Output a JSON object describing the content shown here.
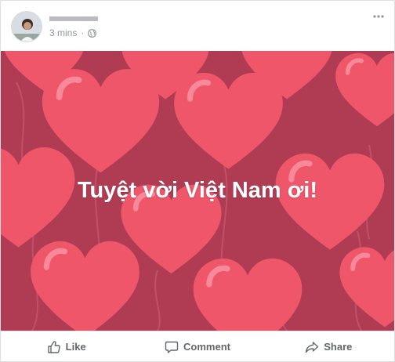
{
  "post": {
    "author_name": "",
    "timestamp": "3 mins",
    "privacy_icon": "globe-icon",
    "more_icon": "more-options-icon",
    "background_color": "#b03c54",
    "heart_color": "#f0566a",
    "text": "Tuyệt vời Việt Nam ơi!"
  },
  "actions": {
    "like": {
      "label": "Like",
      "icon": "thumbs-up-icon"
    },
    "comment": {
      "label": "Comment",
      "icon": "comment-icon"
    },
    "share": {
      "label": "Share",
      "icon": "share-icon"
    }
  }
}
